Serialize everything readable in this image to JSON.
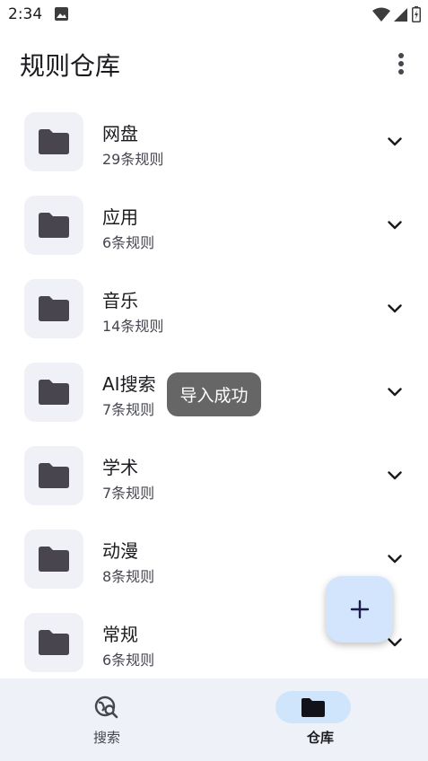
{
  "status_bar": {
    "time": "2:34"
  },
  "app_bar": {
    "title": "规则仓库"
  },
  "folders": [
    {
      "name": "网盘",
      "count": "29条规则"
    },
    {
      "name": "应用",
      "count": "6条规则"
    },
    {
      "name": "音乐",
      "count": "14条规则"
    },
    {
      "name": "AI搜索",
      "count": "7条规则"
    },
    {
      "name": "学术",
      "count": "7条规则"
    },
    {
      "name": "动漫",
      "count": "8条规则"
    },
    {
      "name": "常规",
      "count": "6条规则"
    }
  ],
  "toast": {
    "text": "导入成功"
  },
  "bottom_nav": {
    "items": [
      {
        "label": "搜索",
        "icon": "travel-explore-icon"
      },
      {
        "label": "仓库",
        "icon": "folder-icon",
        "active": true
      }
    ]
  },
  "colors": {
    "folder_tile_bg": "#eff1f7",
    "fab_bg": "#d3e4fd",
    "nav_bg": "#eef1f7",
    "nav_active": "#cfe5fb",
    "toast_bg": "#666666"
  }
}
